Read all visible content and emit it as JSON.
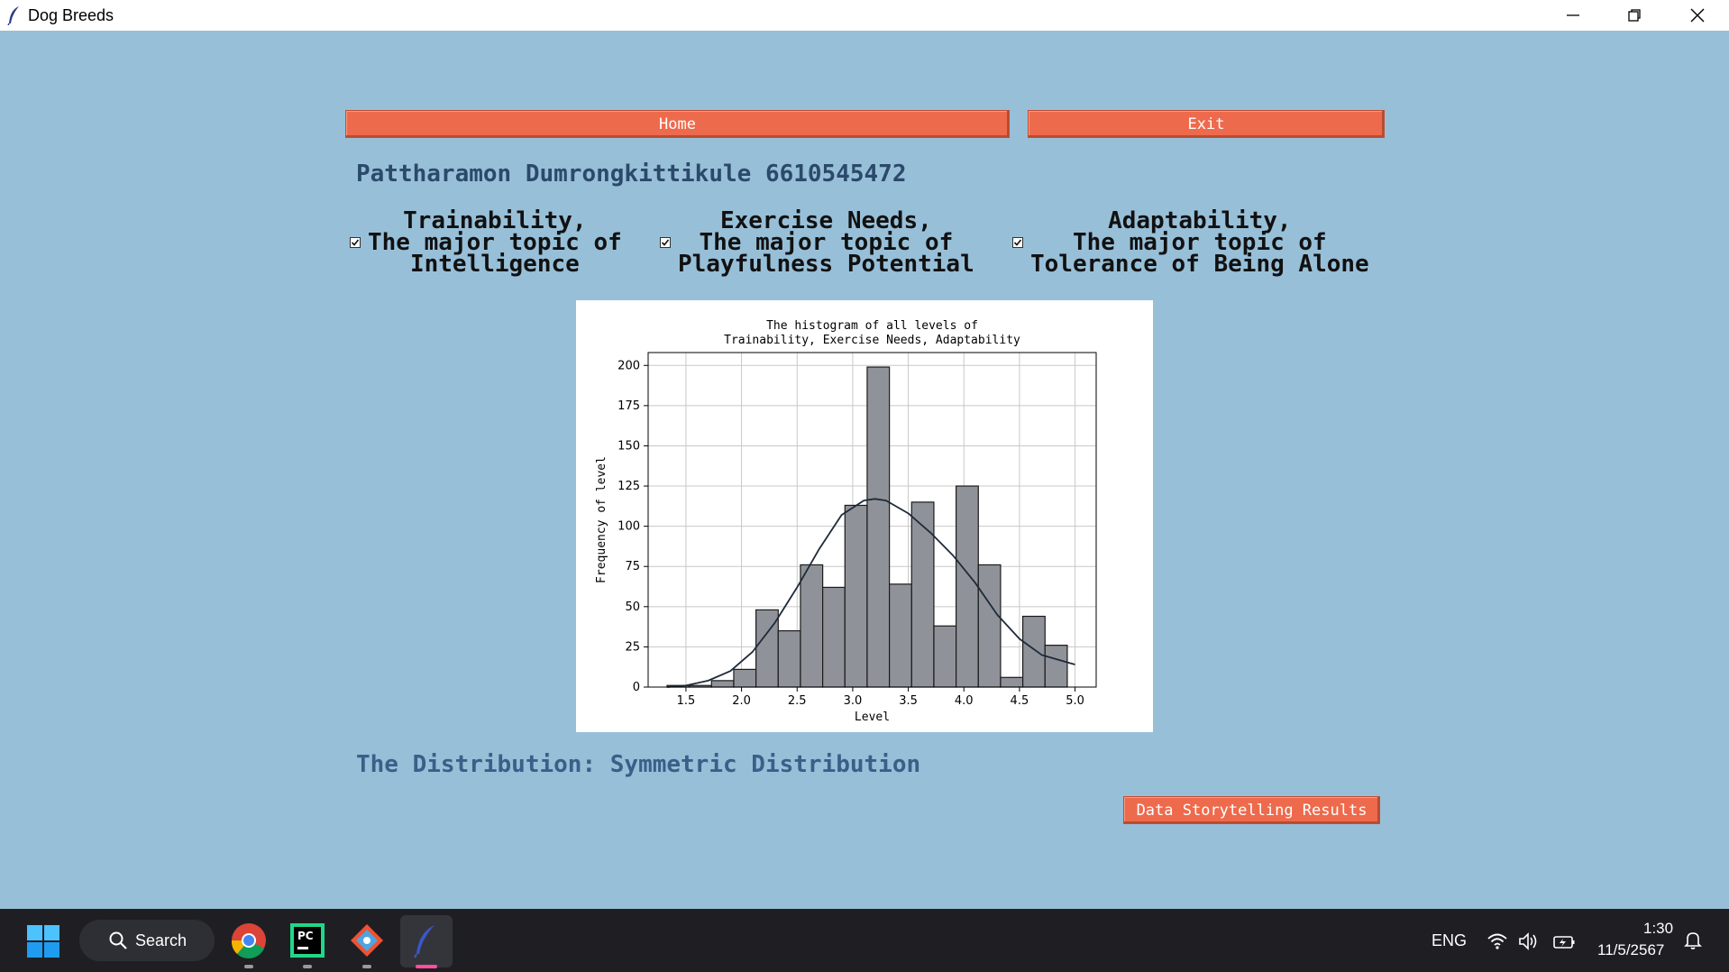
{
  "window": {
    "title": "Dog Breeds"
  },
  "buttons": {
    "home": "Home",
    "exit": "Exit",
    "story": "Data Storytelling Results"
  },
  "student": {
    "name": "Pattharamon Dumrongkittikule 6610545472"
  },
  "checkboxes": [
    {
      "label": "Trainability,\nThe major topic of\nIntelligence",
      "checked": true
    },
    {
      "label": "Exercise Needs,\nThe major topic of\nPlayfulness Potential",
      "checked": true
    },
    {
      "label": "Adaptability,\nThe major topic of\nTolerance of Being Alone",
      "checked": true
    }
  ],
  "distribution_label": "The Distribution: Symmetric Distribution",
  "chart_data": {
    "type": "bar",
    "title": "The histogram of all levels of\nTrainability, Exercise Needs, Adaptability",
    "xlabel": "Level",
    "ylabel": "Frequency of level",
    "xlim": [
      1.16,
      5.19
    ],
    "ylim": [
      0,
      208
    ],
    "xticks": [
      "1.5",
      "2.0",
      "2.5",
      "3.0",
      "3.5",
      "4.0",
      "4.5",
      "5.0"
    ],
    "yticks": [
      "0",
      "25",
      "50",
      "75",
      "100",
      "125",
      "150",
      "175",
      "200"
    ],
    "grid": true,
    "bin_edges": [
      1.33,
      1.53,
      1.73,
      1.93,
      2.13,
      2.33,
      2.53,
      2.73,
      2.93,
      3.13,
      3.33,
      3.53,
      3.73,
      3.93,
      4.13,
      4.33,
      4.53,
      4.73,
      4.93
    ],
    "values": [
      1,
      1,
      4,
      11,
      48,
      35,
      76,
      62,
      113,
      199,
      64,
      115,
      38,
      125,
      76,
      6,
      44,
      26
    ],
    "kde": {
      "x": [
        1.33,
        1.5,
        1.7,
        1.9,
        2.1,
        2.3,
        2.5,
        2.7,
        2.9,
        3.1,
        3.2,
        3.3,
        3.5,
        3.7,
        3.9,
        4.1,
        4.3,
        4.5,
        4.7,
        4.9,
        5.0
      ],
      "y": [
        0,
        1,
        4,
        10,
        22,
        40,
        62,
        86,
        107,
        116,
        117,
        116,
        108,
        96,
        82,
        65,
        45,
        30,
        20,
        16,
        14
      ]
    },
    "colors": {
      "bar": "#8f9399",
      "bar_edge": "#1a1a1a",
      "kde": "#1e2a3a"
    }
  },
  "taskbar": {
    "search": "Search",
    "lang": "ENG",
    "time": "1:30",
    "date": "11/5/2567"
  }
}
